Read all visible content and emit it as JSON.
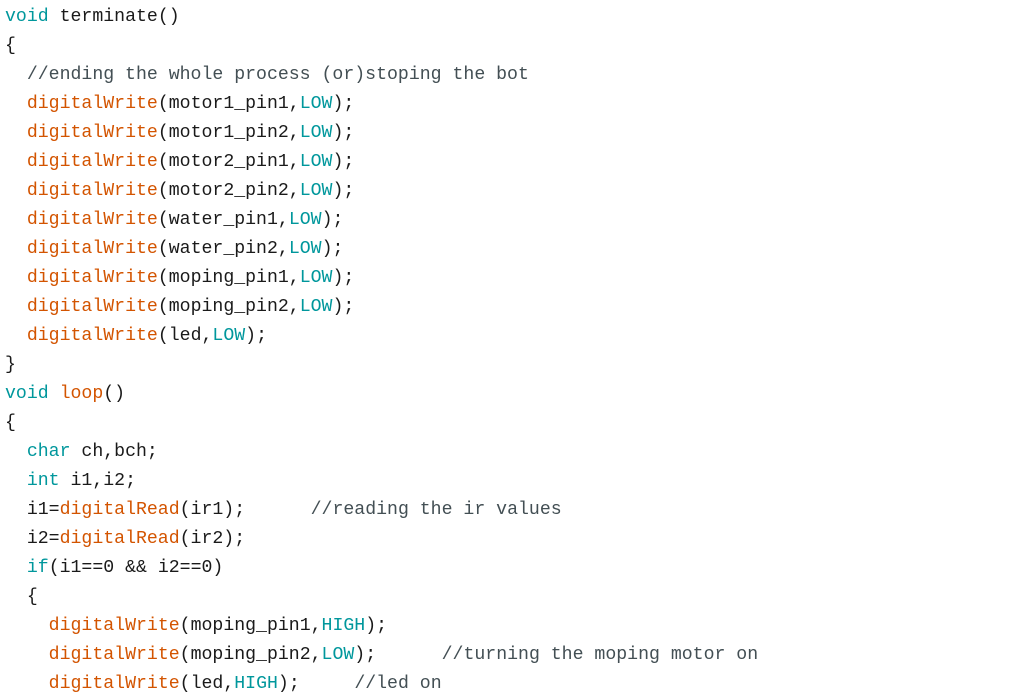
{
  "editor": {
    "language": "arduino",
    "colors": {
      "background": "#ffffff",
      "keyword": "#00979c",
      "function": "#d35400",
      "constant": "#00979c",
      "comment": "#434f54",
      "plain": "#1a1a1a"
    },
    "lines": [
      [
        {
          "t": "void",
          "c": "keyword"
        },
        {
          "t": " terminate()",
          "c": "plain"
        }
      ],
      [
        {
          "t": "{",
          "c": "plain"
        }
      ],
      [
        {
          "t": "  //ending the whole process (or)stoping the bot",
          "c": "comment"
        }
      ],
      [
        {
          "t": "  ",
          "c": "plain"
        },
        {
          "t": "digitalWrite",
          "c": "function"
        },
        {
          "t": "(motor1_pin1,",
          "c": "plain"
        },
        {
          "t": "LOW",
          "c": "constant"
        },
        {
          "t": ");",
          "c": "plain"
        }
      ],
      [
        {
          "t": "  ",
          "c": "plain"
        },
        {
          "t": "digitalWrite",
          "c": "function"
        },
        {
          "t": "(motor1_pin2,",
          "c": "plain"
        },
        {
          "t": "LOW",
          "c": "constant"
        },
        {
          "t": ");",
          "c": "plain"
        }
      ],
      [
        {
          "t": "  ",
          "c": "plain"
        },
        {
          "t": "digitalWrite",
          "c": "function"
        },
        {
          "t": "(motor2_pin1,",
          "c": "plain"
        },
        {
          "t": "LOW",
          "c": "constant"
        },
        {
          "t": ");",
          "c": "plain"
        }
      ],
      [
        {
          "t": "  ",
          "c": "plain"
        },
        {
          "t": "digitalWrite",
          "c": "function"
        },
        {
          "t": "(motor2_pin2,",
          "c": "plain"
        },
        {
          "t": "LOW",
          "c": "constant"
        },
        {
          "t": ");",
          "c": "plain"
        }
      ],
      [
        {
          "t": "  ",
          "c": "plain"
        },
        {
          "t": "digitalWrite",
          "c": "function"
        },
        {
          "t": "(water_pin1,",
          "c": "plain"
        },
        {
          "t": "LOW",
          "c": "constant"
        },
        {
          "t": ");",
          "c": "plain"
        }
      ],
      [
        {
          "t": "  ",
          "c": "plain"
        },
        {
          "t": "digitalWrite",
          "c": "function"
        },
        {
          "t": "(water_pin2,",
          "c": "plain"
        },
        {
          "t": "LOW",
          "c": "constant"
        },
        {
          "t": ");",
          "c": "plain"
        }
      ],
      [
        {
          "t": "  ",
          "c": "plain"
        },
        {
          "t": "digitalWrite",
          "c": "function"
        },
        {
          "t": "(moping_pin1,",
          "c": "plain"
        },
        {
          "t": "LOW",
          "c": "constant"
        },
        {
          "t": ");",
          "c": "plain"
        }
      ],
      [
        {
          "t": "  ",
          "c": "plain"
        },
        {
          "t": "digitalWrite",
          "c": "function"
        },
        {
          "t": "(moping_pin2,",
          "c": "plain"
        },
        {
          "t": "LOW",
          "c": "constant"
        },
        {
          "t": ");",
          "c": "plain"
        }
      ],
      [
        {
          "t": "  ",
          "c": "plain"
        },
        {
          "t": "digitalWrite",
          "c": "function"
        },
        {
          "t": "(led,",
          "c": "plain"
        },
        {
          "t": "LOW",
          "c": "constant"
        },
        {
          "t": ");",
          "c": "plain"
        }
      ],
      [
        {
          "t": "}",
          "c": "plain"
        }
      ],
      [
        {
          "t": "void",
          "c": "keyword"
        },
        {
          "t": " ",
          "c": "plain"
        },
        {
          "t": "loop",
          "c": "function"
        },
        {
          "t": "()",
          "c": "plain"
        }
      ],
      [
        {
          "t": "{",
          "c": "plain"
        }
      ],
      [
        {
          "t": "  ",
          "c": "plain"
        },
        {
          "t": "char",
          "c": "keyword"
        },
        {
          "t": " ch,bch;",
          "c": "plain"
        }
      ],
      [
        {
          "t": "  ",
          "c": "plain"
        },
        {
          "t": "int",
          "c": "keyword"
        },
        {
          "t": " i1,i2;",
          "c": "plain"
        }
      ],
      [
        {
          "t": "  i1=",
          "c": "plain"
        },
        {
          "t": "digitalRead",
          "c": "function"
        },
        {
          "t": "(ir1);      ",
          "c": "plain"
        },
        {
          "t": "//reading the ir values",
          "c": "comment"
        }
      ],
      [
        {
          "t": "  i2=",
          "c": "plain"
        },
        {
          "t": "digitalRead",
          "c": "function"
        },
        {
          "t": "(ir2);",
          "c": "plain"
        }
      ],
      [
        {
          "t": "  ",
          "c": "plain"
        },
        {
          "t": "if",
          "c": "keyword"
        },
        {
          "t": "(i1==0 && i2==0)",
          "c": "plain"
        }
      ],
      [
        {
          "t": "  {",
          "c": "plain"
        }
      ],
      [
        {
          "t": "    ",
          "c": "plain"
        },
        {
          "t": "digitalWrite",
          "c": "function"
        },
        {
          "t": "(moping_pin1,",
          "c": "plain"
        },
        {
          "t": "HIGH",
          "c": "constant"
        },
        {
          "t": ");",
          "c": "plain"
        }
      ],
      [
        {
          "t": "    ",
          "c": "plain"
        },
        {
          "t": "digitalWrite",
          "c": "function"
        },
        {
          "t": "(moping_pin2,",
          "c": "plain"
        },
        {
          "t": "LOW",
          "c": "constant"
        },
        {
          "t": ");      ",
          "c": "plain"
        },
        {
          "t": "//turning the moping motor on",
          "c": "comment"
        }
      ],
      [
        {
          "t": "    ",
          "c": "plain"
        },
        {
          "t": "digitalWrite",
          "c": "function"
        },
        {
          "t": "(led,",
          "c": "plain"
        },
        {
          "t": "HIGH",
          "c": "constant"
        },
        {
          "t": ");     ",
          "c": "plain"
        },
        {
          "t": "//led on",
          "c": "comment"
        }
      ]
    ]
  }
}
